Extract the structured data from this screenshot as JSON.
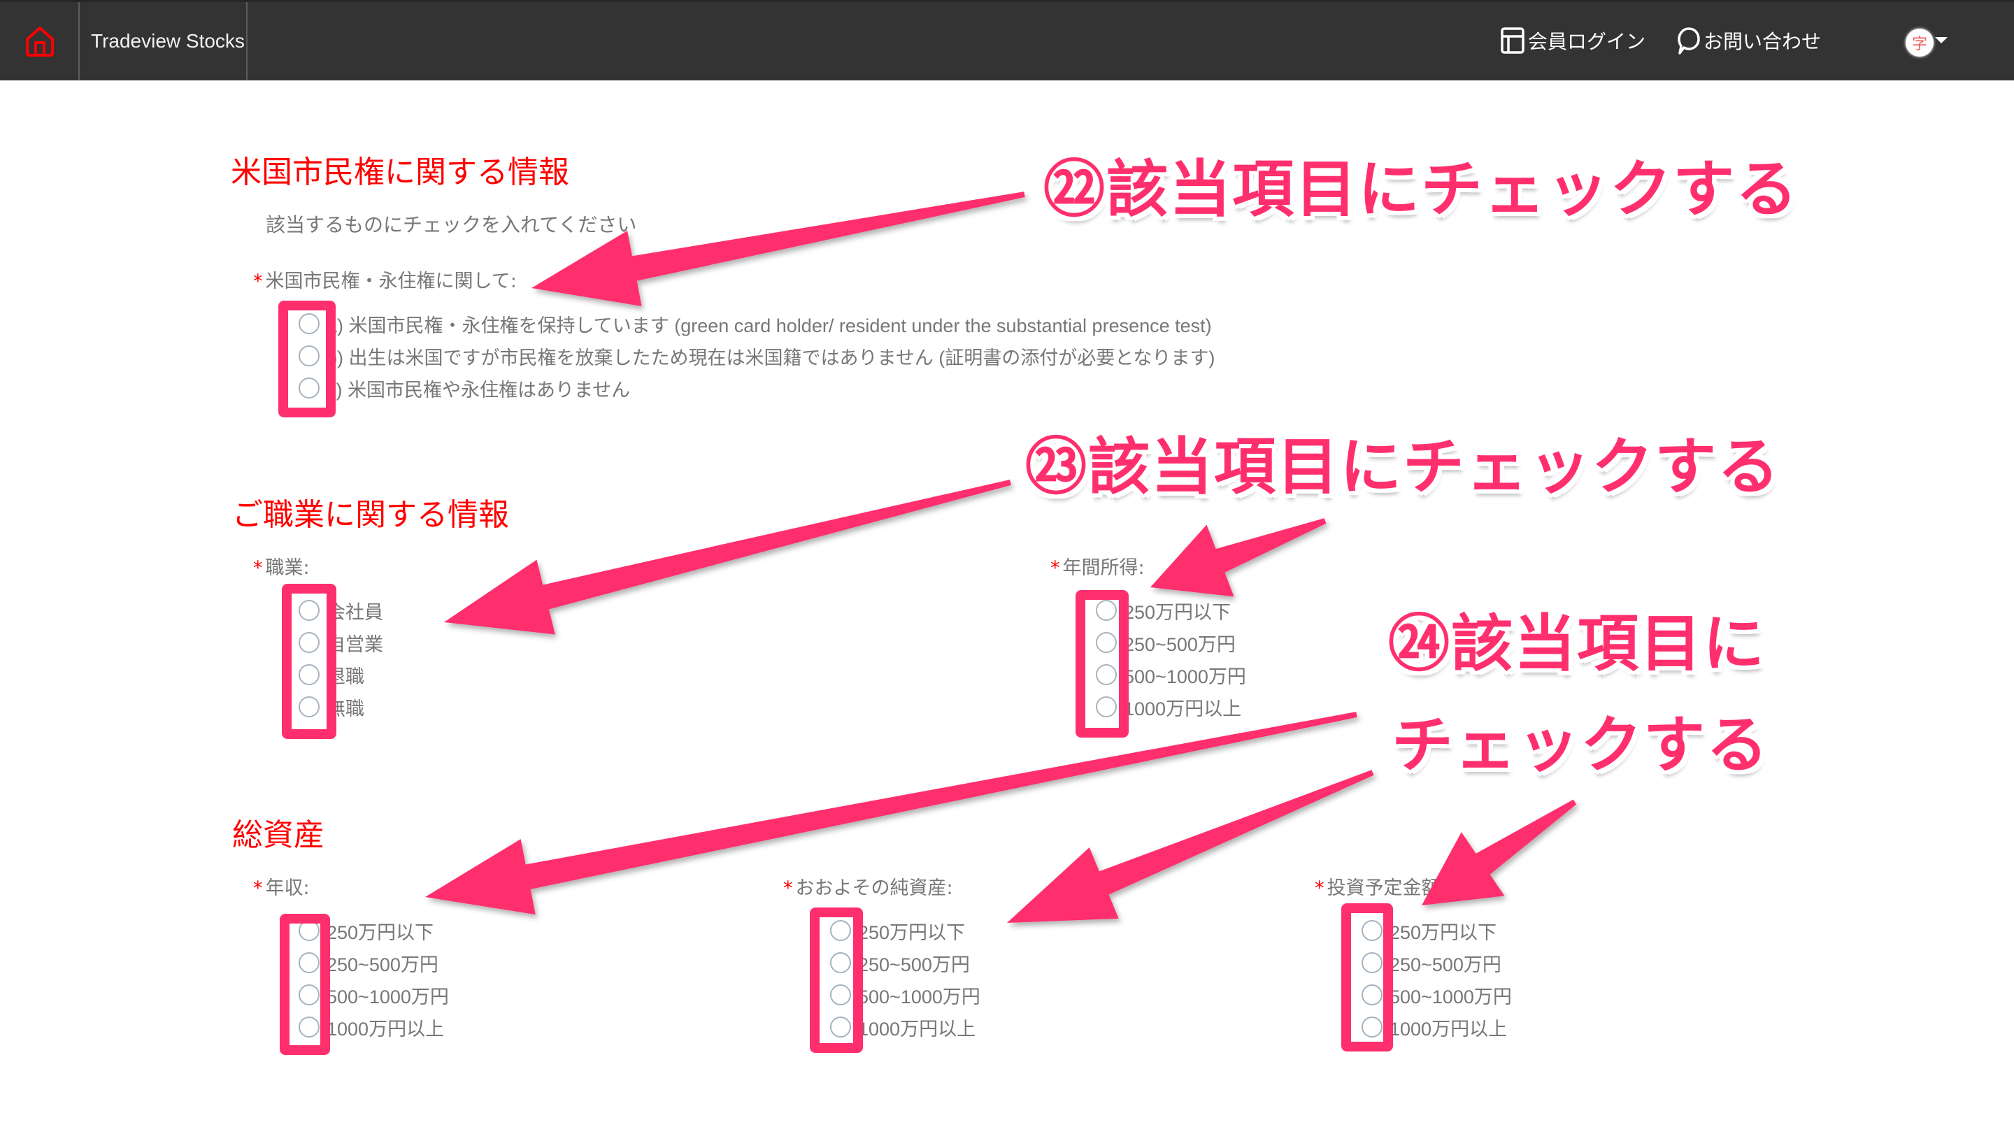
{
  "header": {
    "brand": "Tradeview Stocks",
    "home_icon": "home-icon",
    "login_label": "会員ログイン",
    "login_icon": "layout-icon",
    "contact_label": "お問い合わせ",
    "contact_icon": "speech-bubble-icon",
    "language_avatar": "字",
    "language_icon": "caret-down-icon",
    "accent_color": "#ff0000"
  },
  "sections": {
    "citizenship": {
      "title": "米国市民権に関する情報",
      "hint": "該当するものにチェックを入れてください",
      "field": {
        "label": "米国市民権・永住権に関して:",
        "required": "*",
        "options": [
          "a) 米国市民権・永住権を保持しています (green card holder/ resident under the substantial presence test)",
          "b) 出生は米国ですが市民権を放棄したため現在は米国籍ではありません (証明書の添付が必要となります)",
          "c) 米国市民権や永住権はありません"
        ]
      }
    },
    "occupation": {
      "title": "ご職業に関する情報",
      "job": {
        "label": "職業:",
        "required": "*",
        "options": [
          "会社員",
          "自営業",
          "退職",
          "無職"
        ]
      },
      "annual_income": {
        "label": "年間所得:",
        "required": "*",
        "options": [
          "250万円以下",
          "250~500万円",
          "500~1000万円",
          "1000万円以上"
        ]
      }
    },
    "assets": {
      "title": "総資産",
      "yearly_income": {
        "label": "年収:",
        "required": "*",
        "options": [
          "250万円以下",
          "250~500万円",
          "500~1000万円",
          "1000万円以上"
        ]
      },
      "net_assets": {
        "label": "おおよその純資産:",
        "required": "*",
        "options": [
          "250万円以下",
          "250~500万円",
          "500~1000万円",
          "1000万円以上"
        ]
      },
      "investment_amount": {
        "label": "投資予定金額:",
        "required": "*",
        "options": [
          "250万円以下",
          "250~500万円",
          "500~1000万円",
          "1000万円以上"
        ]
      }
    }
  },
  "annotations": {
    "color": "#ff2f6d",
    "a22": "㉒該当項目にチェックする",
    "a23": "㉓該当項目にチェックする",
    "a24_line1": "㉔該当項目に",
    "a24_line2": "チェックする"
  }
}
